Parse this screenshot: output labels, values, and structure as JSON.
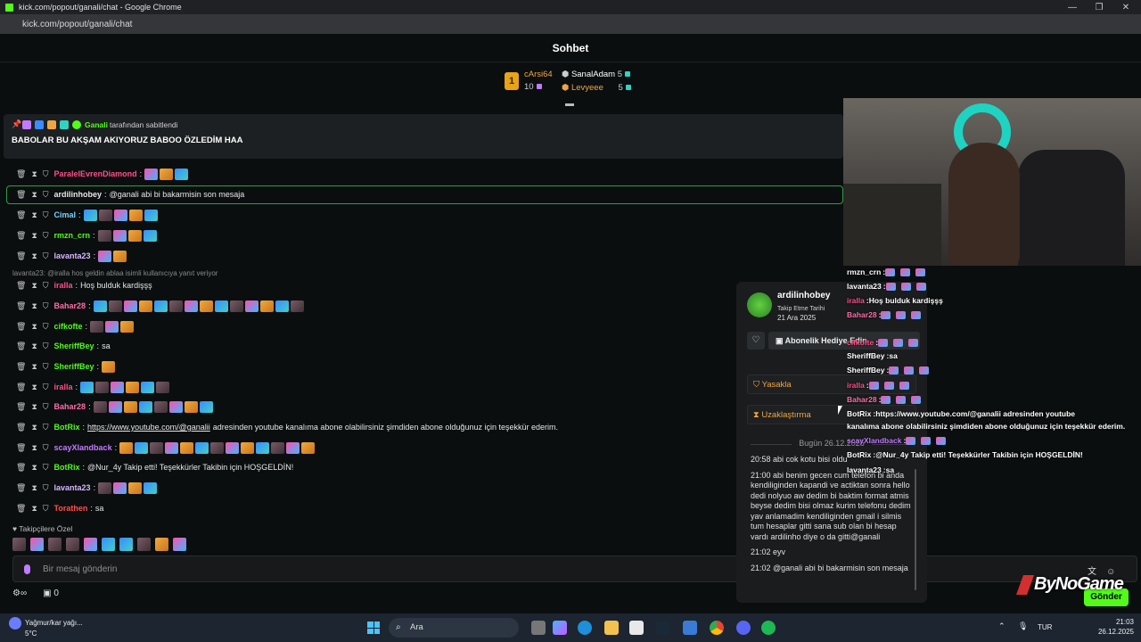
{
  "browser": {
    "window_title": "kick.com/popout/ganali/chat - Google Chrome",
    "url": "kick.com/popout/ganali/chat",
    "minimize": "—",
    "restore": "❐",
    "close": "✕"
  },
  "chat": {
    "title": "Sohbet",
    "leaderboard": [
      {
        "rank": "1",
        "user": "cArsi64",
        "count": "10",
        "color": "#f0a640"
      },
      {
        "user": "SanalAdam",
        "count": "5",
        "color": "#ffffff"
      },
      {
        "user": "Levyeee",
        "count": "5",
        "color": "#f0a640"
      }
    ],
    "pinned": {
      "by_user": "Ganali",
      "by_suffix": "tarafından sabitlendi",
      "text": "BABOLAR BU AKŞAM AKIYORUZ BABOO ÖZLEDİM HAA"
    },
    "reply_context": "lavanta23: @iralla hos geldin ablaa isimli kullanıcıya yanıt veriyor",
    "messages": [
      {
        "user": "ParalelEvrenDiamond",
        "color": "#ff4f8a",
        "text": "",
        "emotes": 3
      },
      {
        "user": "ardilinhobey",
        "color": "#e6e6e6",
        "text": "@ganali abi bi bakarmisin son mesaja",
        "emotes": 0
      },
      {
        "user": "Cimal",
        "color": "#74d6ff",
        "text": "",
        "emotes": 5
      },
      {
        "user": "rmzn_crn",
        "color": "#53fc18",
        "text": "",
        "emotes": 4
      },
      {
        "user": "lavanta23",
        "color": "#d7b8ff",
        "text": "",
        "emotes": 2
      },
      {
        "user": "iralla",
        "color": "#ff4f8a",
        "text": "Hoş bulduk kardişşş",
        "emotes": 0
      },
      {
        "user": "Bahar28",
        "color": "#ff6ea8",
        "text": "",
        "emotes": 14
      },
      {
        "user": "cifkofte",
        "color": "#53fc18",
        "text": "",
        "emotes": 3
      },
      {
        "user": "SheriffBey",
        "color": "#53fc18",
        "text": "sa",
        "emotes": 0
      },
      {
        "user": "SheriffBey",
        "color": "#53fc18",
        "text": "",
        "emotes": 1
      },
      {
        "user": "iralla",
        "color": "#ff4f8a",
        "text": "",
        "emotes": 6
      },
      {
        "user": "Bahar28",
        "color": "#ff6ea8",
        "text": "",
        "emotes": 8
      },
      {
        "user": "BotRix",
        "color": "#53fc18",
        "link": "https://www.youtube.com/@ganalii",
        "text": "adresinden youtube kanalıma abone olabilirsiniz şimdiden abone olduğunuz için teşekkür ederim.",
        "emotes": 0
      },
      {
        "user": "scayXlandback",
        "color": "#c27bff",
        "text": "",
        "emotes": 13
      },
      {
        "user": "BotRix",
        "color": "#53fc18",
        "text": "@Nur_4y Takip etti! Teşekkürler Takibin için HOŞGELDİN!",
        "emotes": 0
      },
      {
        "user": "lavanta23",
        "color": "#d7b8ff",
        "text": "",
        "emotes": 4
      },
      {
        "user": "Torathen",
        "color": "#ff4f4f",
        "text": "sa",
        "emotes": 0
      }
    ],
    "followers_label": "Takipçilere Özel",
    "input_placeholder": "Bir mesaj gönderin",
    "footer_count": "0",
    "send_label": "Gönder"
  },
  "usercard": {
    "username": "ardilinhobey",
    "follow_label": "Takip Etme Tarihi",
    "follow_date": "21 Ara 2025",
    "gift_label": "Abonelik Hediye Edin",
    "ban_label": "Yasakla",
    "timeout_label": "Uzaklaştırma",
    "day_label": "Bugün 26.12.2025",
    "history": [
      "20:58 abi cok kotu bisi oldu",
      "21:00 abi benim gecen cum telefon bi anda kendiliginden kapandi ve actiktan sonra hello dedi nolyuo aw dedim bi baktim format atmis beyse dedim bisi olmaz kurim telefonu dedim yav anlamadim kendiliginden gmail i silmis tum hesaplar gitti sana sub olan bi hesap vardı ardilinho diye o da gitti@ganali",
      "21:02 eyv",
      "21:02 @ganali abi bi bakarmisin son mesaja"
    ]
  },
  "overlay": [
    {
      "user": "rmzn_crn",
      "color": "#ffffff",
      "text": ""
    },
    {
      "user": "lavanta23",
      "color": "#ffffff",
      "text": ""
    },
    {
      "user": "iralla",
      "color": "#ff4f8a",
      "text": "Hoş bulduk kardişşş"
    },
    {
      "user": "Bahar28",
      "color": "#ff6ea8",
      "text": ""
    },
    {
      "user": "cifkofte",
      "color": "#ff4f8a",
      "text": ""
    },
    {
      "user": "SheriffBey",
      "color": "#ffffff",
      "text": "sa"
    },
    {
      "user": "SheriffBey",
      "color": "#ffffff",
      "text": ""
    },
    {
      "user": "iralla",
      "color": "#ff4f8a",
      "text": ""
    },
    {
      "user": "Bahar28",
      "color": "#ff6ea8",
      "text": ""
    },
    {
      "user": "BotRix",
      "color": "#ffffff",
      "text": "https://www.youtube.com/@ganalii adresinden youtube"
    },
    {
      "user": "",
      "color": "#ffffff",
      "text": "kanalıma abone olabilirsiniz şimdiden abone olduğunuz için teşekkür ederim."
    },
    {
      "user": "scayXlandback",
      "color": "#c27bff",
      "text": ""
    },
    {
      "user": "BotRix",
      "color": "#ffffff",
      "text": "@Nur_4y Takip etti! Teşekkürler Takibin için HOŞGELDİN!"
    },
    {
      "user": "lavanta23",
      "color": "#ffffff",
      "text": "sa"
    }
  ],
  "watermark": "ByNoGame",
  "taskbar": {
    "weather_title": "Yağmur/kar yağı...",
    "weather_temp": "5°C",
    "search_placeholder": "Ara",
    "language": "TUR",
    "time": "21:03",
    "date": "26.12.2025"
  }
}
